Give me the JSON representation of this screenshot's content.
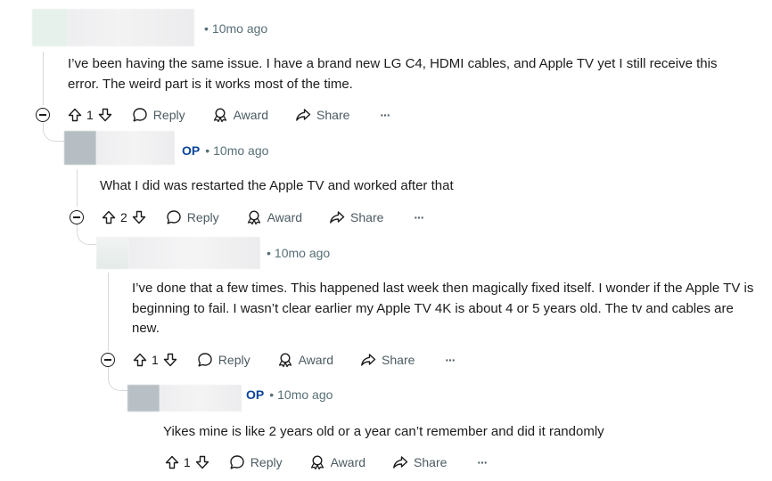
{
  "colors": {
    "op": "#0a449b",
    "meta": "#576f76",
    "thread_line": "#d6d9dc",
    "text": "#1c1c1c"
  },
  "comments": [
    {
      "op_label": "",
      "timestamp": "10mo ago",
      "body": "I’ve been having the same issue. I have a brand new LG C4, HDMI cables, and Apple TV yet I still receive this error. The weird part is it works most of the time.",
      "votes": "1",
      "reply": "Reply",
      "award": "Award",
      "share": "Share",
      "more": "···"
    },
    {
      "op_label": "OP",
      "timestamp": "10mo ago",
      "body": "What I did was restarted the Apple TV and worked after that",
      "votes": "2",
      "reply": "Reply",
      "award": "Award",
      "share": "Share",
      "more": "···"
    },
    {
      "op_label": "",
      "timestamp": "10mo ago",
      "body": "I’ve done that a few times. This happened last week then magically fixed itself. I wonder if the Apple TV is beginning to fail. I wasn’t clear earlier my Apple TV 4K is about 4 or 5 years old. The tv and cables are new.",
      "votes": "1",
      "reply": "Reply",
      "award": "Award",
      "share": "Share",
      "more": "···"
    },
    {
      "op_label": "OP",
      "timestamp": "10mo ago",
      "body": "Yikes mine is like 2 years old or a year can’t remember and did it randomly",
      "votes": "1",
      "reply": "Reply",
      "award": "Award",
      "share": "Share",
      "more": "···"
    }
  ],
  "icons": {
    "upvote": "upvote-arrow-icon",
    "downvote": "downvote-arrow-icon",
    "reply": "speech-bubble-icon",
    "award": "award-ribbon-icon",
    "share": "share-arrow-icon",
    "collapse": "collapse-minus-icon"
  }
}
